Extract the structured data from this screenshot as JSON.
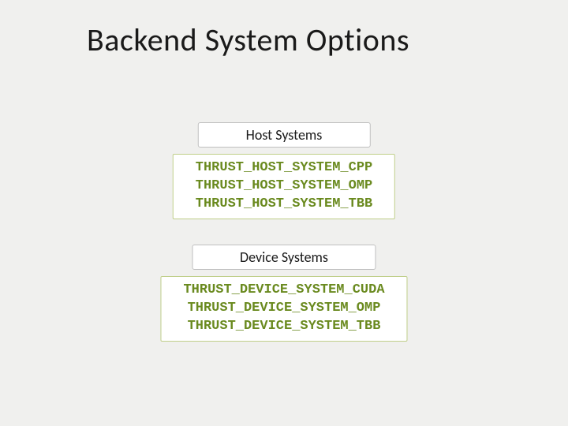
{
  "title": "Backend System Options",
  "host": {
    "label": "Host Systems",
    "lines": {
      "a": "THRUST_HOST_SYSTEM_CPP",
      "b": "THRUST_HOST_SYSTEM_OMP",
      "c": "THRUST_HOST_SYSTEM_TBB"
    }
  },
  "device": {
    "label": "Device Systems",
    "lines": {
      "a": "THRUST_DEVICE_SYSTEM_CUDA",
      "b": "THRUST_DEVICE_SYSTEM_OMP",
      "c": "THRUST_DEVICE_SYSTEM_TBB"
    }
  }
}
